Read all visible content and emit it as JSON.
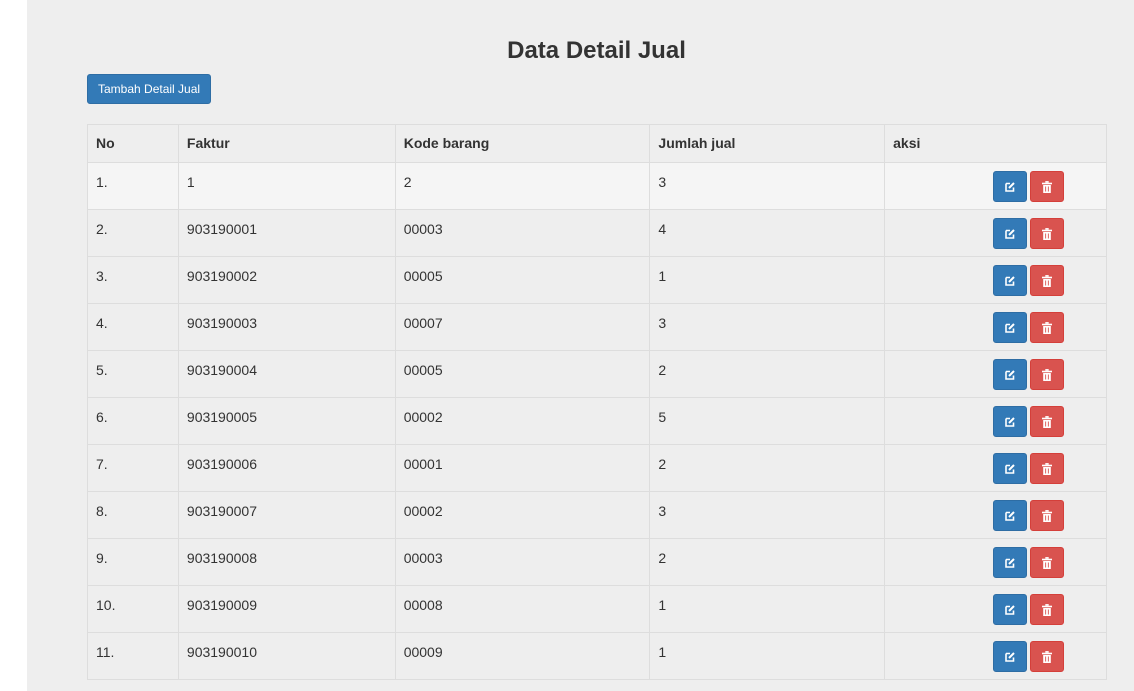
{
  "page": {
    "title": "Data Detail Jual",
    "add_button": "Tambah Detail Jual"
  },
  "table": {
    "headers": {
      "no": "No",
      "faktur": "Faktur",
      "kode": "Kode barang",
      "jumlah": "Jumlah jual",
      "aksi": "aksi"
    },
    "rows": [
      {
        "no": "1.",
        "faktur": "1",
        "kode": "2",
        "jumlah": "3"
      },
      {
        "no": "2.",
        "faktur": "903190001",
        "kode": "00003",
        "jumlah": "4"
      },
      {
        "no": "3.",
        "faktur": "903190002",
        "kode": "00005",
        "jumlah": "1"
      },
      {
        "no": "4.",
        "faktur": "903190003",
        "kode": "00007",
        "jumlah": "3"
      },
      {
        "no": "5.",
        "faktur": "903190004",
        "kode": "00005",
        "jumlah": "2"
      },
      {
        "no": "6.",
        "faktur": "903190005",
        "kode": "00002",
        "jumlah": "5"
      },
      {
        "no": "7.",
        "faktur": "903190006",
        "kode": "00001",
        "jumlah": "2"
      },
      {
        "no": "8.",
        "faktur": "903190007",
        "kode": "00002",
        "jumlah": "3"
      },
      {
        "no": "9.",
        "faktur": "903190008",
        "kode": "00003",
        "jumlah": "2"
      },
      {
        "no": "10.",
        "faktur": "903190009",
        "kode": "00008",
        "jumlah": "1"
      },
      {
        "no": "11.",
        "faktur": "903190010",
        "kode": "00009",
        "jumlah": "1"
      }
    ],
    "row_actions": [
      "edit-icon",
      "trash-icon"
    ]
  },
  "colors": {
    "primary": "#337ab7",
    "danger": "#d9534f",
    "panel_bg": "#eeeeee"
  }
}
